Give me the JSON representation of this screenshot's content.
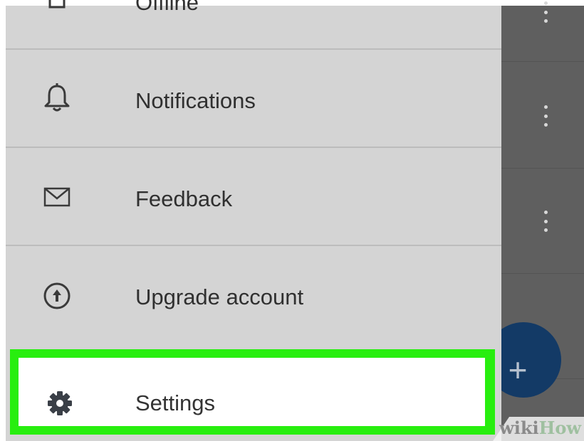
{
  "drawer": {
    "items": [
      {
        "label": "Offline",
        "icon": "offline-icon"
      },
      {
        "label": "Notifications",
        "icon": "bell-icon"
      },
      {
        "label": "Feedback",
        "icon": "envelope-icon"
      },
      {
        "label": "Upgrade account",
        "icon": "upgrade-arrow-icon"
      }
    ],
    "selected": {
      "label": "Settings",
      "icon": "gear-icon"
    }
  },
  "fab": {
    "symbol": "+",
    "icon": "plus-icon",
    "color": "#133a66"
  },
  "highlight_color": "#28ee0f",
  "watermark": {
    "part1": "wiki",
    "part2": "How"
  }
}
